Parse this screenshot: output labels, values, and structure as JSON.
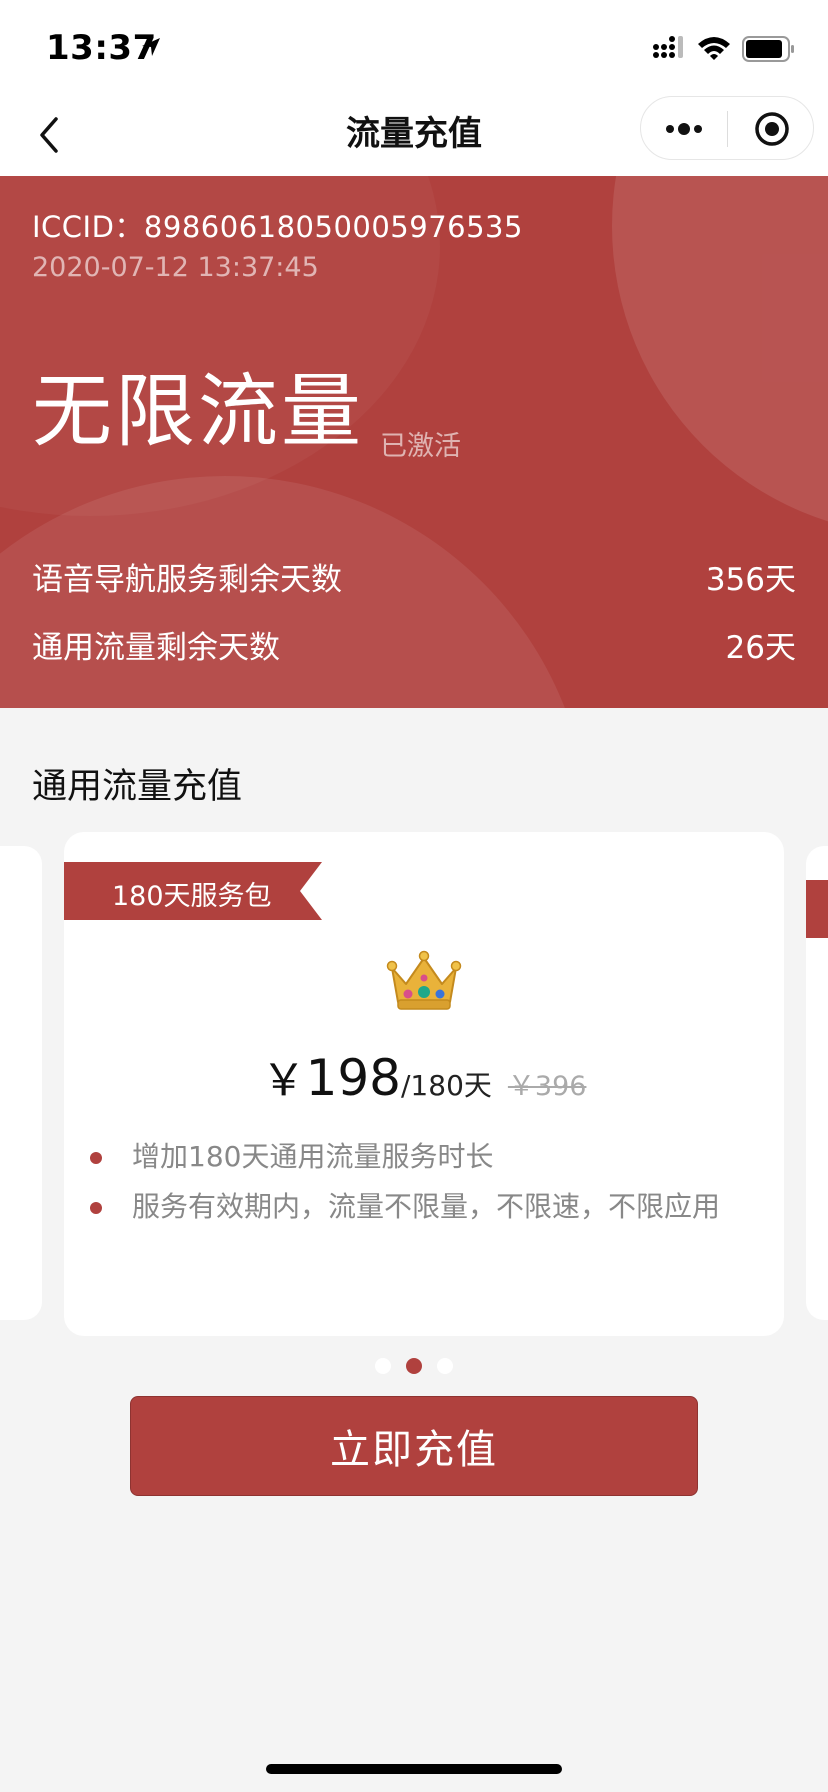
{
  "status_bar": {
    "time": "13:37"
  },
  "nav": {
    "title": "流量充值"
  },
  "hero": {
    "iccid": "ICCID：89860618050005976535",
    "timestamp": "2020-07-12 13:37:45",
    "plan_name": "无限流量",
    "status": "已激活",
    "stats": [
      {
        "label": "语音导航服务剩余天数",
        "value": "356天"
      },
      {
        "label": "通用流量剩余天数",
        "value": "26天"
      }
    ]
  },
  "section": {
    "title": "通用流量充值"
  },
  "card": {
    "badge": "180天服务包",
    "icon": "crown-icon",
    "price_symbol": "￥",
    "price": "198",
    "unit": "/180天",
    "original_price": "￥396",
    "features": [
      "增加180天通用流量服务时长",
      "服务有效期内，流量不限量，不限速，不限应用"
    ]
  },
  "pager": {
    "count": 3,
    "active_index": 1
  },
  "cta": {
    "label": "立即充值"
  },
  "colors": {
    "brand": "#b0413e",
    "background": "#f4f4f4"
  }
}
